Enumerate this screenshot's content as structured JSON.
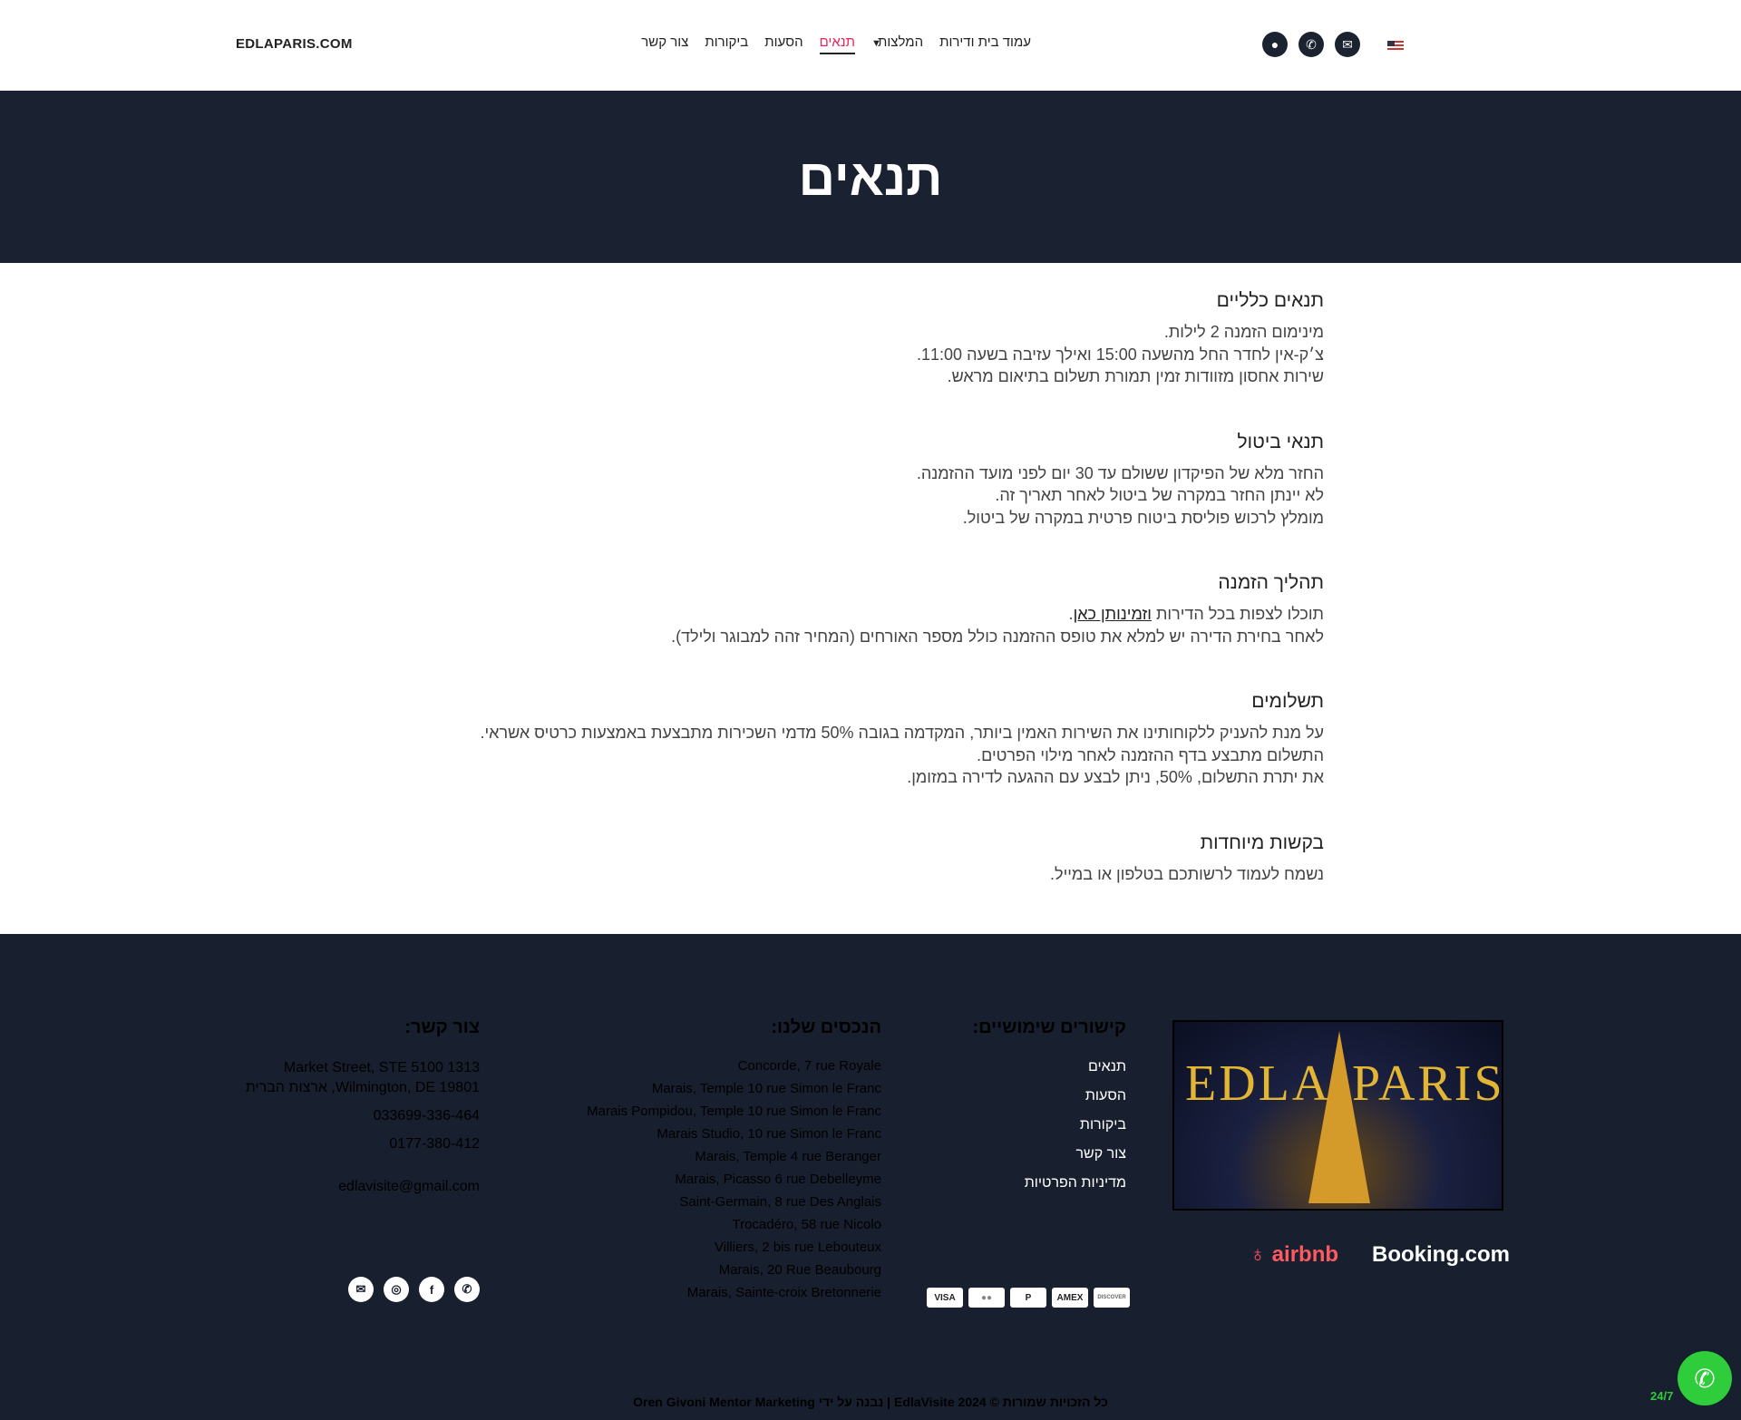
{
  "header": {
    "logo": "EDLAPARIS.COM",
    "nav": [
      "עמוד בית ודירות",
      "המלצות",
      "תנאים",
      "הסעות",
      "ביקורות",
      "צור קשר"
    ],
    "active_index": 2,
    "icons": [
      "user-icon",
      "phone-icon",
      "mail-icon",
      "us-flag-icon"
    ]
  },
  "hero": {
    "title": "תנאים"
  },
  "sections": [
    {
      "title": "תנאים כלליים",
      "lines": [
        "מינימום הזמנה 2 לילות.",
        "צ׳ק-אין לחדר החל מהשעה 15:00 ואילך עזיבה בשעה 11:00.",
        "שירות אחסון מזוודות זמין תמורת תשלום בתיאום מראש."
      ]
    },
    {
      "title": "תנאי ביטול",
      "lines": [
        "החזר מלא של הפיקדון ששולם עד 30 יום לפני מועד ההזמנה.",
        "לא יינתן החזר במקרה של ביטול לאחר תאריך זה.",
        "מומלץ לרכוש פוליסת ביטוח פרטית במקרה של ביטול."
      ]
    },
    {
      "title": "תהליך הזמנה",
      "line1_pre": "תוכלו לצפות בכל הדירות ",
      "line1_link": "וזמינותן כאן",
      "line1_post": ".",
      "lines": [
        "לאחר בחירת הדירה יש למלא את טופס ההזמנה כולל מספר האורחים (המחיר זהה למבוגר ולילד)."
      ]
    },
    {
      "title": "תשלומים",
      "lines": [
        "על מנת להעניק ללקוחותינו את השירות האמין ביותר, המקדמה בגובה 50% מדמי השכירות מתבצעת באמצעות כרטיס אשראי.",
        "התשלום מתבצע בדף ההזמנה לאחר מילוי הפרטים.",
        "את יתרת התשלום, 50%, ניתן לבצע עם ההגעה לדירה במזומן."
      ]
    },
    {
      "title": "בקשות מיוחדות",
      "lines": [
        "נשמח לעמוד לרשותכם בטלפון או במייל."
      ]
    }
  ],
  "footer": {
    "links_title": "קישורים שימושיים:",
    "links": [
      "תנאים",
      "הסעות",
      "ביקורות",
      "צור קשר",
      "מדיניות הפרטיות"
    ],
    "locations_title": "הנכסים שלנו:",
    "locations": [
      "Concorde, 7 rue Royale",
      "Marais, Temple 10 rue Simon le Franc",
      "Marais Pompidou, Temple 10 rue Simon le Franc",
      "Marais Studio, 10 rue Simon le Franc",
      "Marais, Temple 4 rue Beranger",
      "Marais, Picasso 6 rue Debelleyme",
      "Saint-Germain, 8 rue Des Anglais",
      "Trocadéro, 58 rue Nicolo",
      "Villiers, 2 bis rue Lebouteux",
      "Marais, 20 Rue Beaubourg",
      "Marais, Sainte-croix Bretonnerie"
    ],
    "contact_title": "צור קשר:",
    "address1": "Market Street, STE 5100 1313",
    "address2": "Wilmington, DE 19801, ארצות הברית",
    "phone1": "033699-336-464",
    "phone2": "0177-380-412",
    "email": "edlavisite@gmail.com",
    "image_text_left": "EDLA",
    "image_text_right": "PARIS",
    "airbnb": "airbnb",
    "booking": "Booking.com",
    "cards": [
      "VISA",
      "MC",
      "PayPal",
      "AMEX",
      "DISCOVER"
    ],
    "copyright": "כל הזכויות שמורות © EdlaVisite 2024 | נבנה על ידי Oren Givoni Mentor Marketing",
    "whatsapp_label": "24/7"
  },
  "colors": {
    "accent": "#e5245c",
    "dark": "#1a2130",
    "whatsapp": "#2fcc3c",
    "airbnb": "#ff5a5f"
  }
}
